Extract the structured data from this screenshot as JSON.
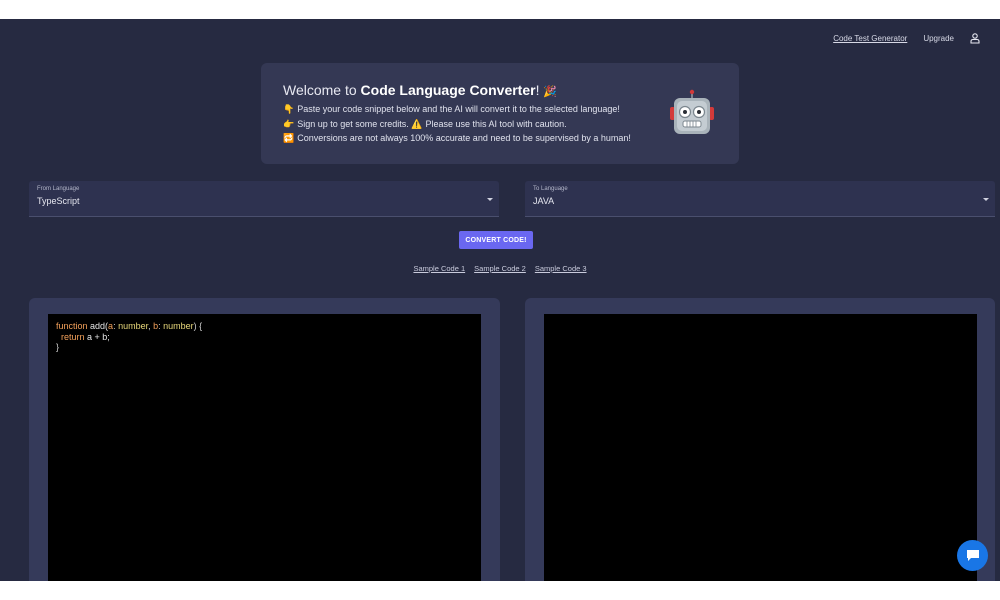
{
  "nav": {
    "code_test_generator": "Code Test Generator",
    "upgrade": "Upgrade",
    "user_icon": "user-icon"
  },
  "welcome": {
    "title_prefix": "Welcome to ",
    "title_bold": "Code Language Converter",
    "title_suffix": "!",
    "lines": [
      {
        "emoji": "👇",
        "text": "Paste your code snippet below and the AI will convert it to the selected language!"
      },
      {
        "emoji": "👉",
        "text": "Sign up to get some credits."
      },
      {
        "emoji": "⚠️",
        "text": "Please use this AI tool with caution."
      },
      {
        "emoji": "🔁",
        "text": "Conversions are not always 100% accurate and need to be supervised by a human!"
      }
    ],
    "title_emoji": "🎉",
    "mascot_icon": "robot-icon"
  },
  "from_language": {
    "label": "From Language",
    "value": "TypeScript"
  },
  "to_language": {
    "label": "To Language",
    "value": "JAVA"
  },
  "convert_button": "CONVERT CODE!",
  "samples": [
    "Sample Code 1",
    "Sample Code 2",
    "Sample Code 3"
  ],
  "input_code": {
    "line1_fn": "function",
    "line1_name": " add(",
    "line1_a": "a",
    "line1_colon1": ": ",
    "line1_type1": "number",
    "line1_comma": ", ",
    "line1_b": "b",
    "line1_colon2": ": ",
    "line1_type2": "number",
    "line1_end": ") {",
    "line2_kw": "  return",
    "line2_rest": " a + b;",
    "line3": "}"
  },
  "output_code": "",
  "chat_icon": "chat-bubble-icon",
  "colors": {
    "background": "#262a41",
    "card": "#343854",
    "accent": "#6a67f1",
    "chat": "#1976e6"
  }
}
